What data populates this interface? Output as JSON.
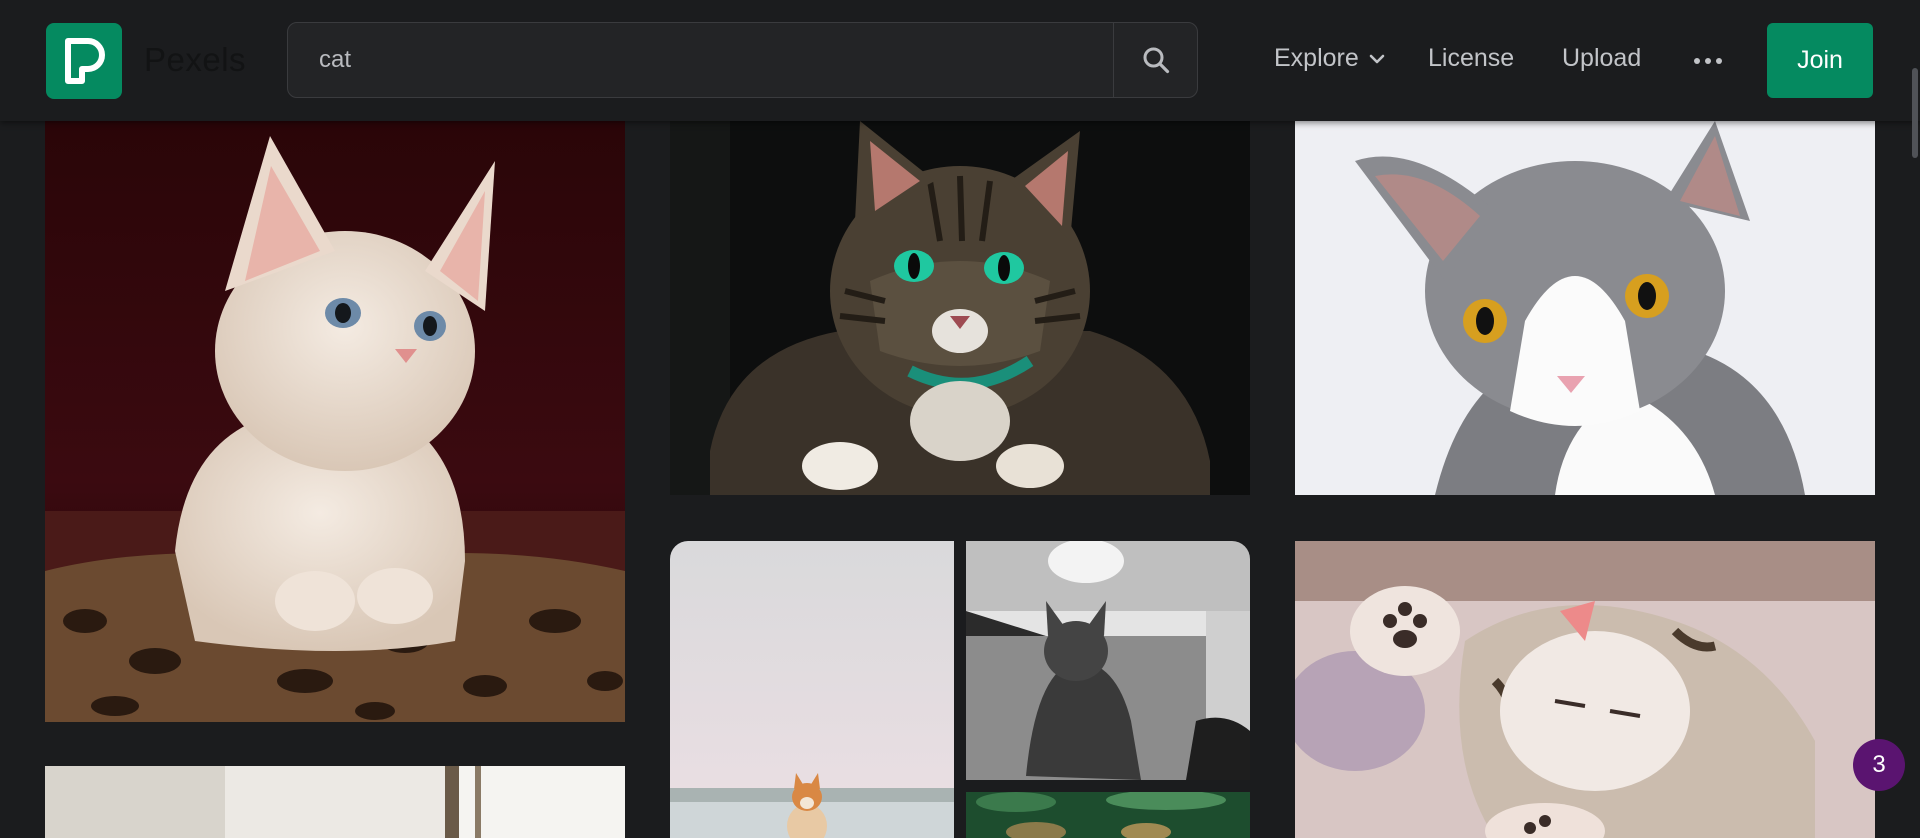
{
  "brand": {
    "name": "Pexels",
    "color": "#058a60"
  },
  "search": {
    "value": "cat",
    "icon": "search-icon"
  },
  "nav": {
    "explore": "Explore",
    "license": "License",
    "upload": "Upload",
    "more_icon": "more-dots-icon",
    "join": "Join"
  },
  "notification_badge": "3",
  "photos": [
    {
      "subject": "white kitten on leopard-print bed"
    },
    {
      "subject": "tabby cat with green eyes and collar"
    },
    {
      "subject": "grey and white cat with yellow eyes"
    },
    {
      "subject": "orange cat by the sea"
    },
    {
      "subject": "grey cat looking up under light"
    },
    {
      "subject": "kitten sleeping on back"
    },
    {
      "subject": "cat by window"
    },
    {
      "subject": "cat in green foliage"
    }
  ]
}
